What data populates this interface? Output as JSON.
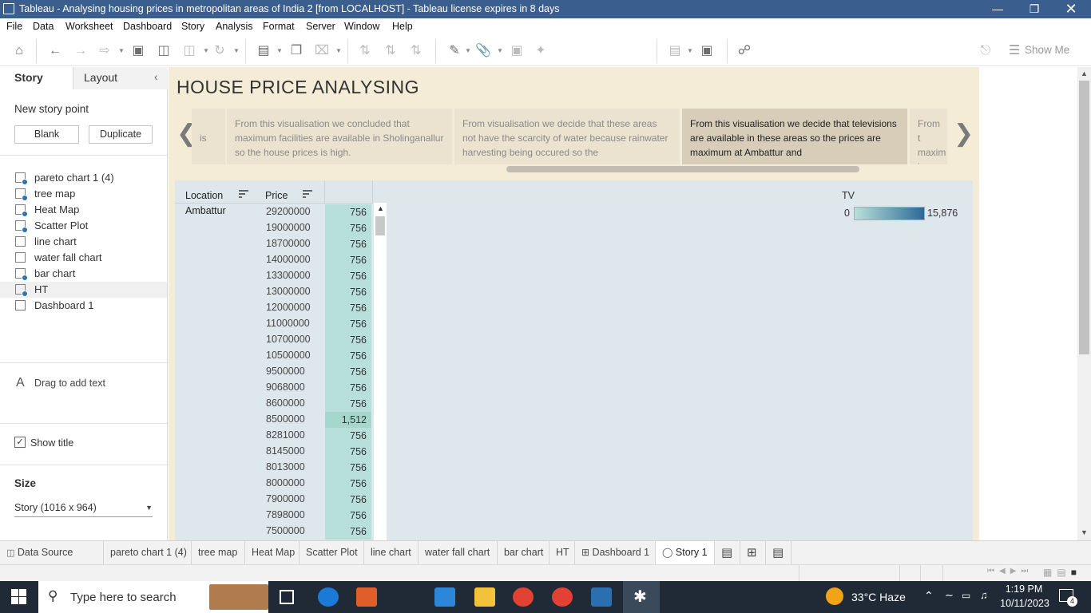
{
  "window": {
    "title": "Tableau - Analysing housing prices in metropolitan areas of India 2 [from LOCALHOST] - Tableau license expires in 8 days"
  },
  "menu": [
    "File",
    "Data",
    "Worksheet",
    "Dashboard",
    "Story",
    "Analysis",
    "Format",
    "Server",
    "Window",
    "Help"
  ],
  "toolbar": {
    "show_me": "Show Me"
  },
  "left_pane": {
    "tabs": [
      "Story",
      "Layout"
    ],
    "new_story_point": "New story point",
    "blank": "Blank",
    "duplicate": "Duplicate",
    "sheets": [
      "pareto chart 1 (4)",
      "tree map",
      "Heat Map",
      "Scatter Plot",
      "line chart",
      "water fall chart",
      "bar chart",
      "HT",
      "Dashboard 1"
    ],
    "drag_text": "Drag to add text",
    "show_title": "Show title",
    "size_label": "Size",
    "size_value": "Story (1016 x 964)"
  },
  "story": {
    "title": "HOUSE PRICE ANALYSING",
    "points": [
      "is",
      "From this visualisation we concluded that maximum facilities are available in Sholinganallur so the house prices is high.",
      "From visualisation we decide that these areas not have the scarcity of water because rainwater harvesting being occured so the",
      "From this visualisation we decide that televisions are available in these areas so the prices are maximum at Ambattur and",
      "From t maxim in Amb"
    ]
  },
  "viz": {
    "col_location": "Location",
    "col_price": "Price",
    "location": "Ambattur",
    "prices": [
      "29200000",
      "19000000",
      "18700000",
      "14000000",
      "13300000",
      "13000000",
      "12000000",
      "11000000",
      "10700000",
      "10500000",
      "9500000",
      "9068000",
      "8600000",
      "8500000",
      "8281000",
      "8145000",
      "8013000",
      "8000000",
      "7900000",
      "7898000",
      "7500000"
    ],
    "tv_values": [
      "756",
      "756",
      "756",
      "756",
      "756",
      "756",
      "756",
      "756",
      "756",
      "756",
      "756",
      "756",
      "756",
      "1,512",
      "756",
      "756",
      "756",
      "756",
      "756",
      "756",
      "756"
    ],
    "legend_title": "TV",
    "legend_min": "0",
    "legend_max": "15,876",
    "color_low": "#b8e0da",
    "color_high": "#2c6a96"
  },
  "tabs": [
    "Data Source",
    "pareto chart 1 (4)",
    "tree map",
    "Heat Map",
    "Scatter Plot",
    "line chart",
    "water fall chart",
    "bar chart",
    "HT",
    "Dashboard 1",
    "Story 1"
  ],
  "taskbar": {
    "search_placeholder": "Type here to search",
    "weather": "33°C  Haze",
    "time": "1:19 PM",
    "date": "10/11/2023",
    "notif_count": "4"
  }
}
